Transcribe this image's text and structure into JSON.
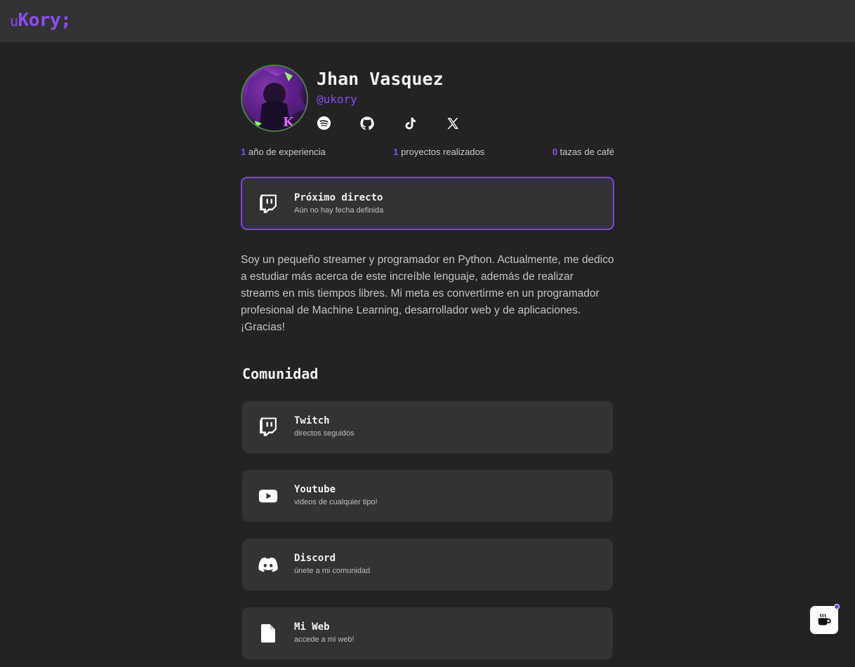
{
  "header": {
    "logo_prefix": "u",
    "logo_main": "Kory;"
  },
  "profile": {
    "name": "Jhan Vasquez",
    "handle": "@ukory",
    "socials": [
      "spotify-icon",
      "github-icon",
      "tiktok-icon",
      "x-icon"
    ]
  },
  "stats": [
    {
      "value": "1",
      "label": "año de experiencia"
    },
    {
      "value": "1",
      "label": "proyectos realizados"
    },
    {
      "value": "0",
      "label": "tazas de café"
    }
  ],
  "next_live": {
    "title": "Próximo directo",
    "subtitle": "Aún no hay fecha definida"
  },
  "bio": "Soy un pequeño streamer y programador en Python. Actualmente, me dedico a estudiar más acerca de este increíble lenguaje, además de realizar streams en mis tiempos libres. Mi meta es convertirme en un programador profesional de Machine Learning, desarrollador web y de aplicaciones. ¡Gracias!",
  "community": {
    "title": "Comunidad",
    "links": [
      {
        "title": "Twitch",
        "subtitle": "directos seguidos"
      },
      {
        "title": "Youtube",
        "subtitle": "videos de cualquier tipo!"
      },
      {
        "title": "Discord",
        "subtitle": "únete a mi comunidad"
      },
      {
        "title": "Mi Web",
        "subtitle": "accede a mi web!"
      }
    ]
  },
  "colors": {
    "accent": "#8a4cf2",
    "background": "#232323",
    "card": "#333334"
  }
}
